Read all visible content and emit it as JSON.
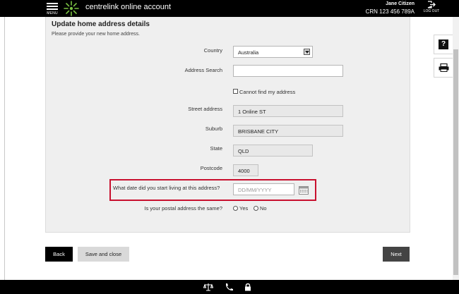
{
  "header": {
    "menu_label": "MENU",
    "app_title": "centrelink online account",
    "user_name": "Jane Citizen",
    "crn": "CRN 123 456 789A",
    "logout_label": "LOG OUT"
  },
  "form": {
    "title": "Update home address details",
    "subtitle": "Please provide your new home address.",
    "country": {
      "label": "Country",
      "value": "Australia"
    },
    "address_search": {
      "label": "Address Search",
      "value": ""
    },
    "cannot_find": {
      "label": "Cannot find my address",
      "checked": false
    },
    "street": {
      "label": "Street address",
      "value": "1 Online ST"
    },
    "suburb": {
      "label": "Suburb",
      "value": "BRISBANE CITY"
    },
    "state": {
      "label": "State",
      "value": "QLD"
    },
    "postcode": {
      "label": "Postcode",
      "value": "4000"
    },
    "start_date": {
      "label": "What date did you start living at this address?",
      "placeholder": "DD/MM/YYYY"
    },
    "postal_same": {
      "label": "Is your postal address the same?",
      "yes_label": "Yes",
      "no_label": "No"
    }
  },
  "buttons": {
    "back": "Back",
    "save_close": "Save and close",
    "next": "Next"
  },
  "side_icons": [
    "help-icon",
    "print-icon"
  ],
  "footer_icons": [
    "scales-icon",
    "phone-icon",
    "lock-icon"
  ],
  "colors": {
    "header": "#000000",
    "highlight": "#c8102e",
    "panel": "#efefef",
    "logo_green": "#7ac143"
  }
}
